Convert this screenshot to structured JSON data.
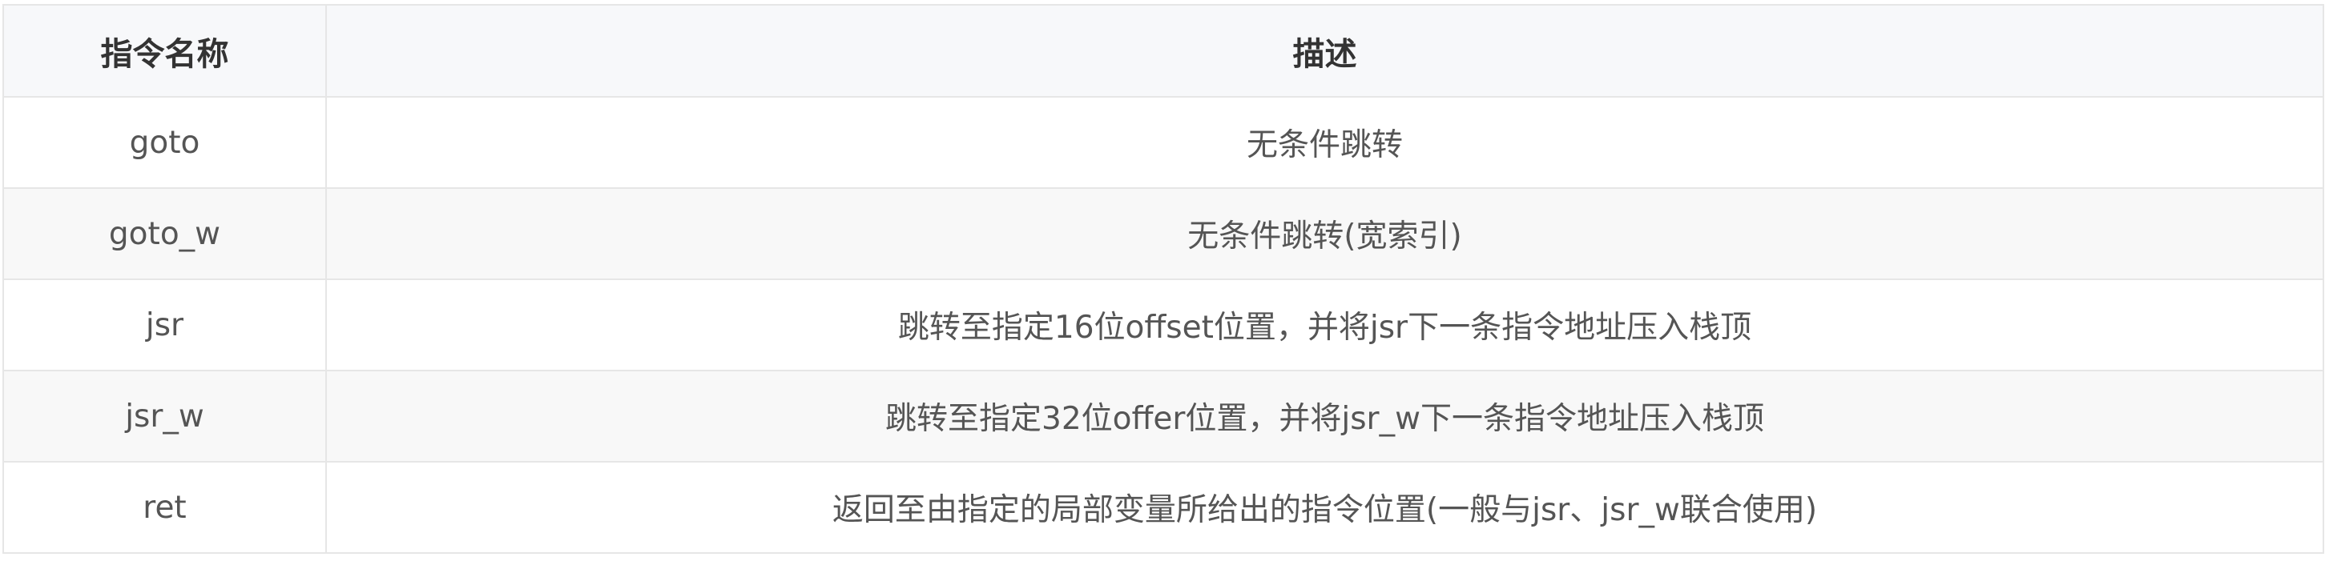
{
  "table": {
    "headers": [
      "指令名称",
      "描述"
    ],
    "rows": [
      [
        "goto",
        "无条件跳转"
      ],
      [
        "goto_w",
        "无条件跳转(宽索引)"
      ],
      [
        "jsr",
        "跳转至指定16位offset位置，并将jsr下一条指令地址压入栈顶"
      ],
      [
        "jsr_w",
        "跳转至指定32位offer位置，并将jsr_w下一条指令地址压入栈顶"
      ],
      [
        "ret",
        "返回至由指定的局部变量所给出的指令位置(一般与jsr、jsr_w联合使用)"
      ]
    ]
  },
  "colors": {
    "header_bg": "#f7f8fa",
    "row_alt_bg": "#f8f8f8",
    "border": "#e6e6e6"
  }
}
